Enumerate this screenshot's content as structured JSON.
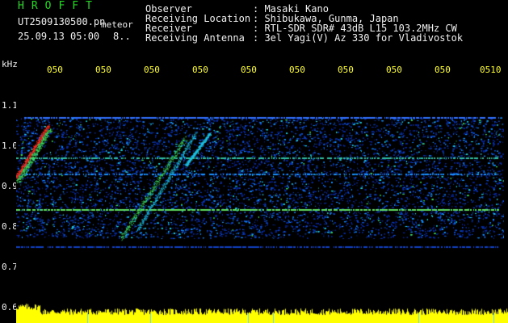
{
  "header": {
    "app_title": "HROFFT",
    "file_name": "UT2509130500.pn",
    "plot_type": "meteor",
    "date_time": "25.09.13 05:00",
    "minute": "8.."
  },
  "station_info": [
    {
      "label": "Observer",
      "value": ": Masaki Kano"
    },
    {
      "label": "Receiving Location",
      "value": ": Shibukawa, Gunma, Japan"
    },
    {
      "label": "Receiver",
      "value": ": RTL-SDR SDR# 43dB L15 103.2MHz CW"
    },
    {
      "label": "Receiving Antenna",
      "value": ": 3el Yagi(V) Az 330 for Vladivostok"
    }
  ],
  "y_axis": {
    "unit": "kHz",
    "ticks": [
      "1.1",
      "1.0",
      "0.9",
      "0.8",
      "0.7",
      "0.6"
    ]
  },
  "x_axis": {
    "ticks": [
      "050",
      "050",
      "050",
      "050",
      "050",
      "050",
      "050",
      "050",
      "050",
      "0510"
    ]
  },
  "colors": {
    "background": "#000000",
    "text": "#f0f0f0",
    "title": "#23d823",
    "time_ticks": "#ffff30",
    "strip": "#ffff00"
  }
}
